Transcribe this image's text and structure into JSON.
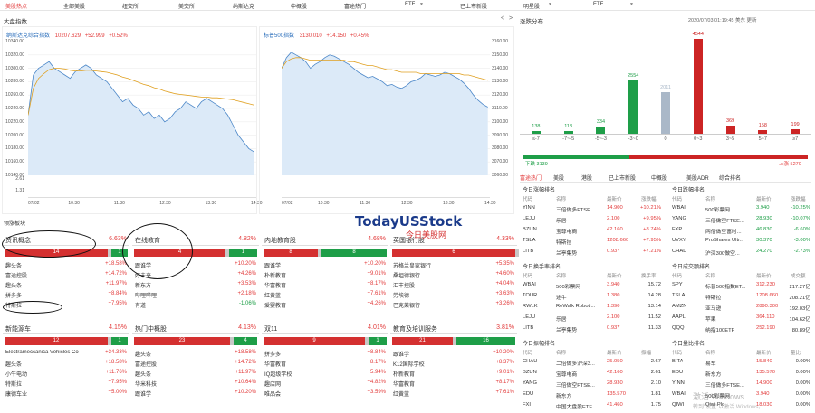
{
  "topnav": {
    "tabs": [
      {
        "label": "美股热点",
        "active": true
      },
      {
        "label": "全部美股"
      },
      {
        "label": "纽交所"
      },
      {
        "label": "美交所"
      },
      {
        "label": "纳斯达克"
      },
      {
        "label": "中概股"
      },
      {
        "label": "富途热门"
      },
      {
        "label": "ETF"
      },
      {
        "label": "已上市新股"
      },
      {
        "label": "明星股"
      },
      {
        "label": "ETF"
      }
    ]
  },
  "market_index": {
    "title": "大盘指数",
    "nasdaq": {
      "name": "纳斯达克综合指数",
      "price": "10207.629",
      "change": "+52.999",
      "pct": "+0.52%",
      "yticks": [
        "10340.00",
        "10320.00",
        "10300.00",
        "10280.00",
        "10260.00",
        "10240.00",
        "10220.00",
        "10200.00",
        "10180.00",
        "10160.00",
        "10140.00"
      ],
      "vol": [
        "2.61",
        "1.31"
      ],
      "xticks": [
        "07/02",
        "10:30",
        "11:30",
        "12:30",
        "13:30",
        "14:30"
      ],
      "line": [
        10230,
        10290,
        10300,
        10305,
        10310,
        10300,
        10295,
        10290,
        10285,
        10295,
        10300,
        10305,
        10300,
        10290,
        10285,
        10280,
        10270,
        10260,
        10250,
        10255,
        10245,
        10240,
        10230,
        10235,
        10225,
        10230,
        10220,
        10225,
        10235,
        10240,
        10250,
        10245,
        10240,
        10250,
        10255,
        10250,
        10245,
        10240,
        10230,
        10215,
        10200,
        10190,
        10180,
        10175
      ],
      "avg": [
        10230,
        10270,
        10285,
        10292,
        10298,
        10300,
        10300,
        10299,
        10297,
        10296,
        10296,
        10297,
        10297,
        10296,
        10295,
        10294,
        10292,
        10290,
        10287,
        10285,
        10282,
        10279,
        10276,
        10274,
        10271,
        10269,
        10266,
        10264,
        10262,
        10261,
        10260,
        10259,
        10258,
        10257,
        10257,
        10256,
        10256,
        10255,
        10254,
        10253,
        10251,
        10249,
        10247,
        10245
      ]
    },
    "sp500": {
      "name": "标普500指数",
      "price": "3130.010",
      "change": "+14.150",
      "pct": "+0.45%",
      "yticks": [
        "3160.00",
        "3150.00",
        "3140.00",
        "3130.00",
        "3120.00",
        "3110.00",
        "3100.00",
        "3090.00",
        "3080.00",
        "3070.00",
        "3060.00"
      ],
      "xticks": [
        "07/02",
        "10:30",
        "11:30",
        "12:30",
        "13:30",
        "14:30"
      ],
      "line": [
        3140,
        3148,
        3152,
        3150,
        3148,
        3145,
        3140,
        3143,
        3145,
        3148,
        3150,
        3149,
        3147,
        3145,
        3143,
        3140,
        3137,
        3135,
        3133,
        3134,
        3132,
        3130,
        3127,
        3128,
        3126,
        3125,
        3127,
        3130,
        3131,
        3133,
        3136,
        3135,
        3134,
        3135,
        3137,
        3136,
        3134,
        3132,
        3129,
        3125,
        3120,
        3116,
        3113,
        3111
      ],
      "avg": [
        3140,
        3145,
        3147,
        3148,
        3148,
        3147,
        3146,
        3146,
        3146,
        3146,
        3146,
        3146,
        3146,
        3146,
        3145,
        3145,
        3144,
        3143,
        3142,
        3142,
        3141,
        3140,
        3139,
        3139,
        3138,
        3137,
        3137,
        3137,
        3137,
        3136,
        3136,
        3136,
        3136,
        3136,
        3136,
        3136,
        3136,
        3136,
        3135,
        3135,
        3134,
        3133,
        3132,
        3131
      ]
    }
  },
  "dist": {
    "title": "涨跌分布",
    "time": "2020/07/03 01:19:45 美东 更新",
    "buckets": [
      {
        "label": "≤-7",
        "count": "138",
        "v": 138,
        "color": "#1e9e48"
      },
      {
        "label": "-7~-5",
        "count": "113",
        "v": 113,
        "color": "#1e9e48"
      },
      {
        "label": "-5~-3",
        "count": "334",
        "v": 334,
        "color": "#1e9e48"
      },
      {
        "label": "-3~0",
        "count": "2554",
        "v": 2554,
        "color": "#1e9e48"
      },
      {
        "label": "0",
        "count": "2011",
        "v": 2011,
        "color": "#aab8c8"
      },
      {
        "label": "0~3",
        "count": "4544",
        "v": 4544,
        "color": "#cc2424"
      },
      {
        "label": "3~5",
        "count": "369",
        "v": 369,
        "color": "#cc2424"
      },
      {
        "label": "5~7",
        "count": "158",
        "v": 158,
        "color": "#cc2424"
      },
      {
        "label": "≥7",
        "count": "199",
        "v": 199,
        "color": "#cc2424"
      }
    ],
    "down_label": "下跌 3139",
    "up_label": "上涨 5270",
    "down_frac": 0.373
  },
  "hot": {
    "title": "领涨板块",
    "cards": [
      {
        "name": "资讯概念",
        "pct": "6.63%",
        "up": "14",
        "dn": "1",
        "upf": 0.9,
        "stocks": [
          [
            "趣头条",
            ""
          ],
          [
            "富途控股",
            ""
          ],
          [
            "趣头条",
            ""
          ],
          [
            "拼多多",
            ""
          ],
          [
            "特斯拉",
            ""
          ]
        ],
        "pcts": [
          "+18.58%",
          "+14.72%",
          "+11.97%",
          "+8.84%",
          "+7.95%"
        ]
      },
      {
        "name": "在线教育",
        "pct": "4.82%",
        "up": "4",
        "dn": "1",
        "upf": 0.8,
        "stocks": [
          [
            "跟谁学",
            ""
          ],
          [
            "好未来",
            ""
          ],
          [
            "新东方",
            ""
          ],
          [
            "哔哩哔哩",
            ""
          ],
          [
            "有道",
            ""
          ]
        ],
        "pcts": [
          "+10.20%",
          "+4.26%",
          "+3.53%",
          "+2.18%",
          "-1.06%"
        ]
      },
      {
        "name": "内地教育股",
        "pct": "4.68%",
        "up": "8",
        "dn": "8",
        "upf": 0.5,
        "stocks": [
          [
            "跟谁学",
            ""
          ],
          [
            "朴新教育",
            ""
          ],
          [
            "华富教育",
            ""
          ],
          [
            "红黄蓝",
            ""
          ],
          [
            "爱婴教育",
            ""
          ]
        ],
        "pcts": [
          "+10.20%",
          "+9.01%",
          "+8.17%",
          "+7.61%",
          "+4.26%"
        ]
      },
      {
        "name": "英国银行股",
        "pct": "4.33%",
        "up": "6",
        "dn": "",
        "upf": 1,
        "stocks": [
          [
            "苏格兰皇家银行",
            ""
          ],
          [
            "桑坦德银行",
            ""
          ],
          [
            "汇丰控股",
            ""
          ],
          [
            "劳埃德",
            ""
          ],
          [
            "巴克莱银行",
            ""
          ]
        ],
        "pcts": [
          "+5.35%",
          "+4.60%",
          "+4.04%",
          "+3.63%",
          "+3.26%"
        ]
      },
      {
        "name": "新能源车",
        "pct": "4.15%",
        "up": "12",
        "dn": "1",
        "upf": 0.9,
        "stocks": [
          [
            "Electrameccanica Vehicles Co",
            ""
          ],
          [
            "趣头条",
            ""
          ],
          [
            "小牛电动",
            ""
          ],
          [
            "特斯拉",
            ""
          ],
          [
            "康德车业",
            ""
          ]
        ],
        "pcts": [
          "+34.33%",
          "+18.58%",
          "+11.76%",
          "+7.95%",
          "+5.00%"
        ]
      },
      {
        "name": "热门中概股",
        "pct": "4.13%",
        "up": "23",
        "dn": "4",
        "upf": 0.84,
        "stocks": [
          [
            "趣头条",
            ""
          ],
          [
            "富途控股",
            ""
          ],
          [
            "趣头条",
            ""
          ],
          [
            "华米科技",
            ""
          ],
          [
            "跟谁学",
            ""
          ]
        ],
        "pcts": [
          "+18.58%",
          "+14.72%",
          "+11.97%",
          "+10.64%",
          "+10.20%"
        ]
      },
      {
        "name": "双11",
        "pct": "4.01%",
        "up": "9",
        "dn": "1",
        "upf": 0.88,
        "stocks": [
          [
            "拼多多",
            ""
          ],
          [
            "华富教育",
            ""
          ],
          [
            "IQ超级学校",
            ""
          ],
          [
            "趣店网",
            ""
          ],
          [
            "唯品会",
            ""
          ]
        ],
        "pcts": [
          "+8.84%",
          "+8.17%",
          "+5.94%",
          "+4.82%",
          "+3.59%"
        ]
      },
      {
        "name": "教育及培训服务",
        "pct": "3.81%",
        "up": "21",
        "dn": "16",
        "upf": 0.55,
        "stocks": [
          [
            "跟谁学",
            ""
          ],
          [
            "K12国际学校",
            ""
          ],
          [
            "朴新教育",
            ""
          ],
          [
            "华富教育",
            ""
          ],
          [
            "红黄蓝",
            ""
          ]
        ],
        "pcts": [
          "+10.20%",
          "+8.37%",
          "+9.01%",
          "+8.17%",
          "+7.61%"
        ]
      }
    ]
  },
  "right": {
    "tabs": [
      "富途热门",
      "美股",
      "港股",
      "已上市新股",
      "中概股",
      "美股ADR",
      "综合排名"
    ],
    "gainers": {
      "title": "今日涨幅排名",
      "cols": [
        "代码",
        "名称",
        "最新价",
        "涨跌幅"
      ],
      "rows": [
        [
          "YINN",
          "三倍做多FTSE...",
          "14.900",
          "+10.21%"
        ],
        [
          "LEJU",
          "乐居",
          "2.100",
          "+9.95%"
        ],
        [
          "BZUN",
          "宝尊电商",
          "42.160",
          "+8.74%"
        ],
        [
          "TSLA",
          "特斯拉",
          "1208.660",
          "+7.95%"
        ],
        [
          "LITB",
          "兰亭集势",
          "0.937",
          "+7.21%"
        ]
      ]
    },
    "losers": {
      "title": "今日跌幅排名",
      "cols": [
        "代码",
        "名称",
        "最新价",
        "涨跌幅"
      ],
      "rows": [
        [
          "WBAI",
          "500彩票网",
          "3.940",
          "-10.25%"
        ],
        [
          "YANG",
          "三倍做空FTSE...",
          "28.930",
          "-10.07%"
        ],
        [
          "FXP",
          "两倍做空富时...",
          "46.830",
          "-6.60%"
        ],
        [
          "UVXY",
          "ProShares Ultr...",
          "30.370",
          "-3.00%"
        ],
        [
          "CHAD",
          "沪深300做空...",
          "24.270",
          "-2.73%"
        ]
      ]
    },
    "turnover": {
      "title": "今日换手率排名",
      "cols": [
        "代码",
        "名称",
        "最新价",
        "换手率"
      ],
      "rows": [
        [
          "WBAI",
          "500彩票网",
          "3.940",
          "15.72"
        ],
        [
          "TOUR",
          "途牛",
          "1.380",
          "14.28"
        ],
        [
          "RWLK",
          "ReWalk Roboti...",
          "1.390",
          "13.14"
        ],
        [
          "LEJU",
          "乐居",
          "2.100",
          "11.52"
        ],
        [
          "LITB",
          "兰亭集势",
          "0.937",
          "11.33"
        ]
      ]
    },
    "volume": {
      "title": "今日成交额排名",
      "cols": [
        "代码",
        "名称",
        "最新价",
        "成交额"
      ],
      "rows": [
        [
          "SPY",
          "标普500指数ET...",
          "312.230",
          "217.27亿"
        ],
        [
          "TSLA",
          "特斯拉",
          "1208.660",
          "208.21亿"
        ],
        [
          "AMZN",
          "亚马逊",
          "2890.300",
          "192.03亿"
        ],
        [
          "AAPL",
          "苹果",
          "364.110",
          "104.62亿"
        ],
        [
          "QQQ",
          "纳指100ETF",
          "252.190",
          "80.89亿"
        ]
      ]
    },
    "amp1": {
      "title": "今日振幅排名",
      "cols": [
        "代码",
        "名称",
        "最新价",
        "振幅"
      ],
      "rows": [
        [
          "CHAU",
          "二倍做多沪深3...",
          "25.050",
          "2.67"
        ],
        [
          "BZUN",
          "宝尊电商",
          "42.160",
          "2.61"
        ],
        [
          "YANG",
          "三倍做空FTSE...",
          "28.930",
          "2.10"
        ],
        [
          "EDU",
          "新东方",
          "135.570",
          "1.81"
        ],
        [
          "FXI",
          "中国大盘股ETF...",
          "41.460",
          "1.75"
        ]
      ]
    },
    "amp2": {
      "title": "今日量比排名",
      "cols": [
        "代码",
        "名称",
        "最新价",
        "量比"
      ],
      "rows": [
        [
          "BITA",
          "易车",
          "15.840",
          "0.00%"
        ],
        [
          "EDU",
          "新东方",
          "135.570",
          "0.00%"
        ],
        [
          "YINN",
          "三倍做多FTSE...",
          "14.900",
          "0.00%"
        ],
        [
          "WBAI",
          "500彩票网",
          "3.940",
          "0.00%"
        ],
        [
          "QIWI",
          "Qiwi Plc",
          "18.030",
          "0.00%"
        ]
      ]
    }
  },
  "watermark": {
    "brand": "TodayUSStock",
    "sub": "今日美股网"
  },
  "windows": {
    "line1": "激活 Windows",
    "line2": "转到\"设置\"以激活 Windows。"
  }
}
